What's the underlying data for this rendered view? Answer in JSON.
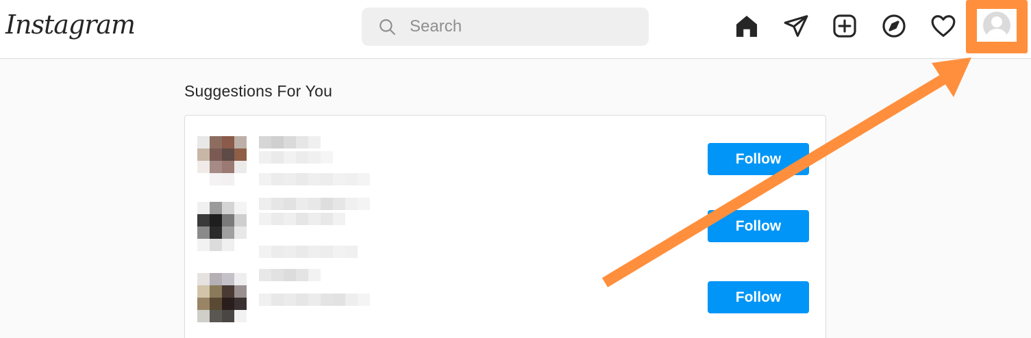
{
  "header": {
    "logo_text": "Instagram",
    "search_placeholder": "Search",
    "icons": [
      "home-icon",
      "direct-icon",
      "new-post-icon",
      "explore-icon",
      "activity-icon",
      "profile-icon"
    ]
  },
  "suggestions": {
    "title": "Suggestions For You",
    "items": [
      {
        "follow_label": "Follow"
      },
      {
        "follow_label": "Follow"
      },
      {
        "follow_label": "Follow"
      }
    ]
  },
  "colors": {
    "annotation_orange": "#ff8f3c",
    "follow_blue": "#0095f6"
  }
}
